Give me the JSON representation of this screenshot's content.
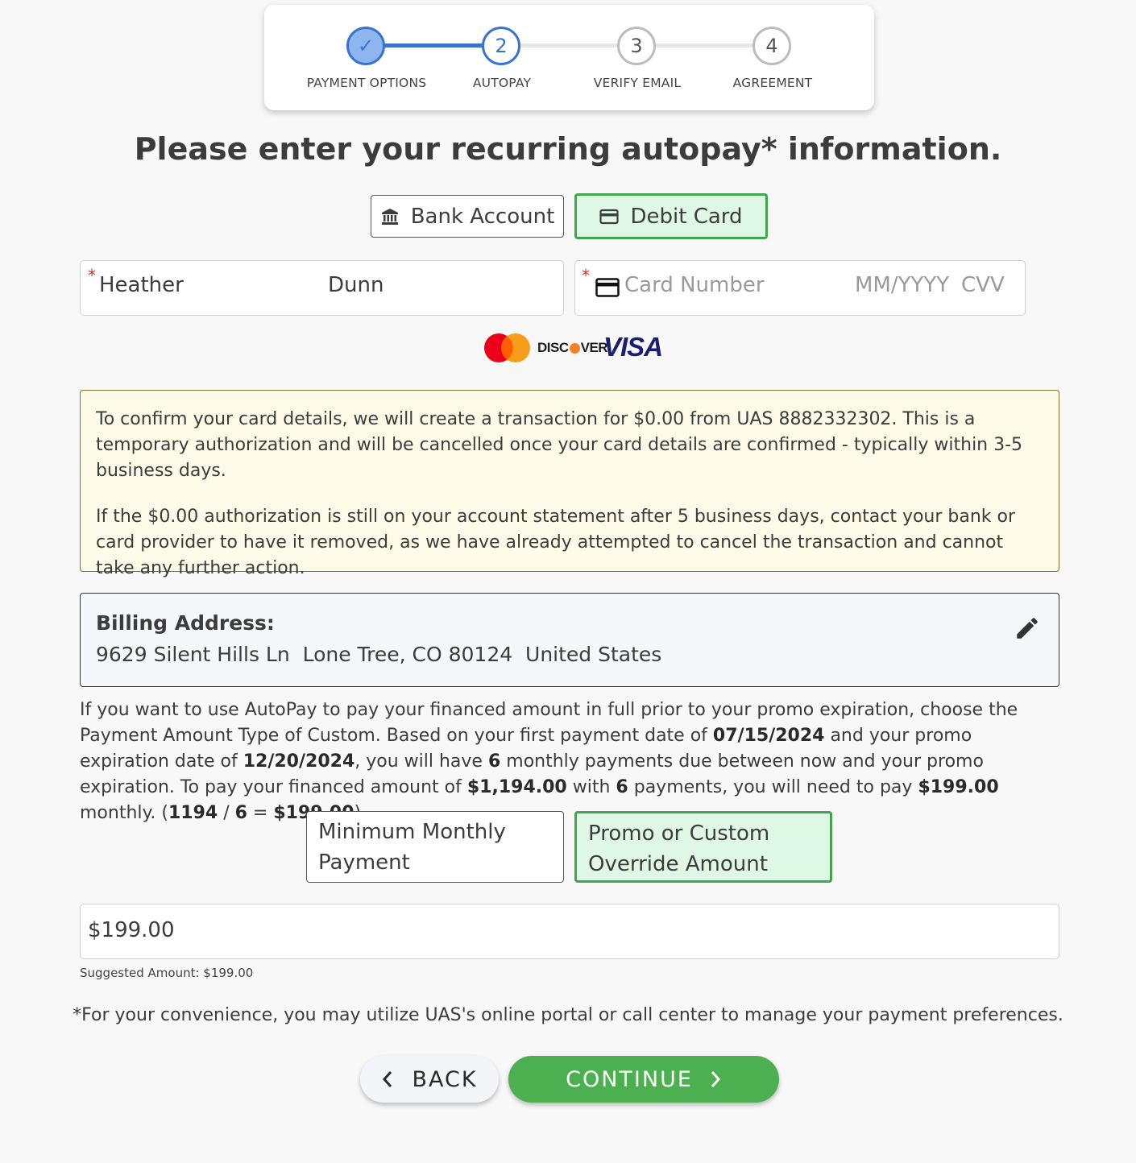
{
  "stepper": {
    "steps": [
      {
        "label": "PAYMENT OPTIONS",
        "marker": "✓",
        "state": "done"
      },
      {
        "label": "AUTOPAY",
        "marker": "2",
        "state": "current"
      },
      {
        "label": "VERIFY EMAIL",
        "marker": "3",
        "state": "todo"
      },
      {
        "label": "AGREEMENT",
        "marker": "4",
        "state": "todo"
      }
    ]
  },
  "page_title": "Please enter your recurring autopay* information.",
  "method_toggle": {
    "bank_label": "Bank Account",
    "debit_label": "Debit Card",
    "selected": "debit"
  },
  "name_field": {
    "required_mark": "*",
    "first_name": "Heather",
    "last_name": "Dunn"
  },
  "card_field": {
    "required_mark": "*",
    "card_placeholder": "Card Number",
    "expiry_placeholder": "MM/YYYY",
    "cvv_placeholder": "CVV"
  },
  "card_brands": {
    "discover_text_1": "DISC",
    "discover_text_2": "VER",
    "visa_text": "VISA"
  },
  "notice": {
    "p1": "To confirm your card details, we will create a transaction for $0.00 from UAS 8882332302. This is a temporary authorization and will be cancelled once your card details are confirmed - typically within 3-5 business days.",
    "p2": "If the $0.00 authorization is still on your account statement after 5 business days, contact your bank or card provider to have it removed, as we have already attempted to cancel the transaction and cannot take any further action."
  },
  "billing": {
    "label": "Billing Address:",
    "address": "9629 Silent Hills Ln  Lone Tree, CO 80124  United States"
  },
  "explain": {
    "t1": "If you want to use AutoPay to pay your financed amount in full prior to your promo expiration, choose the Payment Amount Type of Custom. Based on your first payment date of ",
    "first_date": "07/15/2024",
    "t2": " and your promo expiration date of ",
    "promo_date": "12/20/2024",
    "t3": ", you will have ",
    "count": "6",
    "t4": " monthly payments due between now and your promo expiration. To pay your financed amount of ",
    "financed": "$1,194.00",
    "t5": " with ",
    "t6": " payments, you will need to pay ",
    "monthly": "$199.00",
    "t7": " monthly. (",
    "calc_total": "1194",
    "t8": " / ",
    "t9": " = ",
    "t10": ")."
  },
  "amount_type": {
    "minimum_label": "Minimum Monthly Payment",
    "custom_label": "Promo or Custom Override Amount",
    "selected": "custom"
  },
  "amount_input": {
    "value": "$199.00"
  },
  "suggested": "Suggested Amount: $199.00",
  "footnote": "*For your convenience, you may utilize UAS's online portal or call center to manage your payment preferences.",
  "buttons": {
    "back": "BACK",
    "continue": "CONTINUE"
  },
  "colors": {
    "accent_blue": "#3a72d0",
    "selected_green": "#3fa64b",
    "continue_green": "#4caf50"
  }
}
